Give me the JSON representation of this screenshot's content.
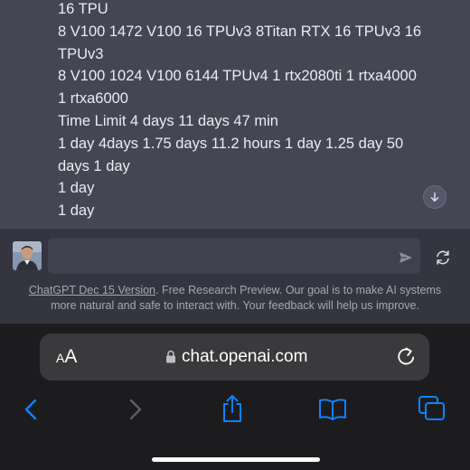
{
  "chat": {
    "lines": [
      "16 TPU",
      "8 V100 1472 V100 16 TPUv3 8Titan RTX 16 TPUv3 16",
      "TPUv3",
      "8 V100 1024 V100 6144 TPUv4 1 rtx2080ti 1 rtxa4000",
      "1 rtxa6000",
      "Time Limit 4 days 11 days 47 min",
      "1 day 4days 1.75 days 11.2 hours 1 day 1.25 day 50",
      "days 1 day",
      "1 day",
      "1 day"
    ],
    "cutoff_text": "— — — — — —"
  },
  "composer": {
    "placeholder": ""
  },
  "footer": {
    "link_text": "ChatGPT Dec 15 Version",
    "text": ". Free Research Preview. Our goal is to make AI systems more natural and safe to interact with. Your feedback will help us improve."
  },
  "browser": {
    "aa_large": "A",
    "aa_small": "A",
    "url": "chat.openai.com"
  },
  "icons": {
    "scroll_down": "arrow-down-icon",
    "send": "paper-plane-icon",
    "refresh": "refresh-icon",
    "lock": "lock-icon",
    "reload": "reload-icon",
    "back": "chevron-left-icon",
    "forward": "chevron-right-icon",
    "share": "share-icon",
    "bookmarks": "book-icon",
    "tabs": "tabs-icon"
  },
  "colors": {
    "accent": "#0a84ff",
    "chat_bg": "#444654",
    "page_bg": "#343541",
    "chrome_bg": "#1c1c1e"
  }
}
